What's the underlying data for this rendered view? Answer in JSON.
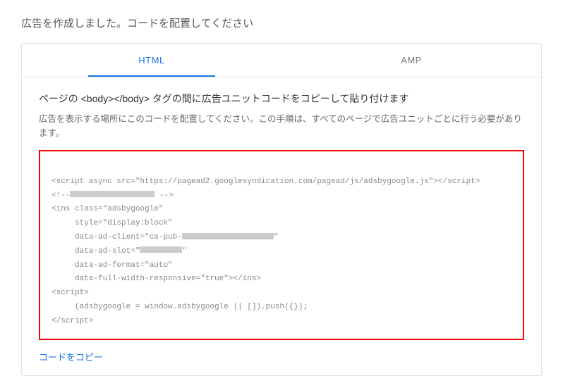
{
  "pageTitle": "広告を作成しました。コードを配置してください",
  "tabs": {
    "html": "HTML",
    "amp": "AMP"
  },
  "section": {
    "title": "ページの <body></body> タグの間に広告ユニットコードをコピーして貼り付けます",
    "desc": "広告を表示する場所にこのコードを配置してください。この手順は、すべてのページで広告ユニットごとに行う必要があります。"
  },
  "code": {
    "l1a": "<script async src=\"https://pagead2.googlesyndication.com/pagead/js/adsbygoogle.js\"><",
    "l1b": "/script>",
    "l2a": "<!--",
    "l2b": " -->",
    "l3": "<ins class=\"adsbygoogle\"",
    "l4": "     style=\"display:block\"",
    "l5a": "     data-ad-client=\"ca-pub-",
    "l5b": "\"",
    "l6a": "     data-ad-slot=\"",
    "l6b": "\"",
    "l7": "     data-ad-format=\"auto\"",
    "l8": "     data-full-width-responsive=\"true\"></ins>",
    "l9": "<script>",
    "l10": "     (adsbygoogle = window.adsbygoogle || []).push({});",
    "l11a": "<",
    "l11b": "/script>"
  },
  "copyLink": "コードをコピー"
}
